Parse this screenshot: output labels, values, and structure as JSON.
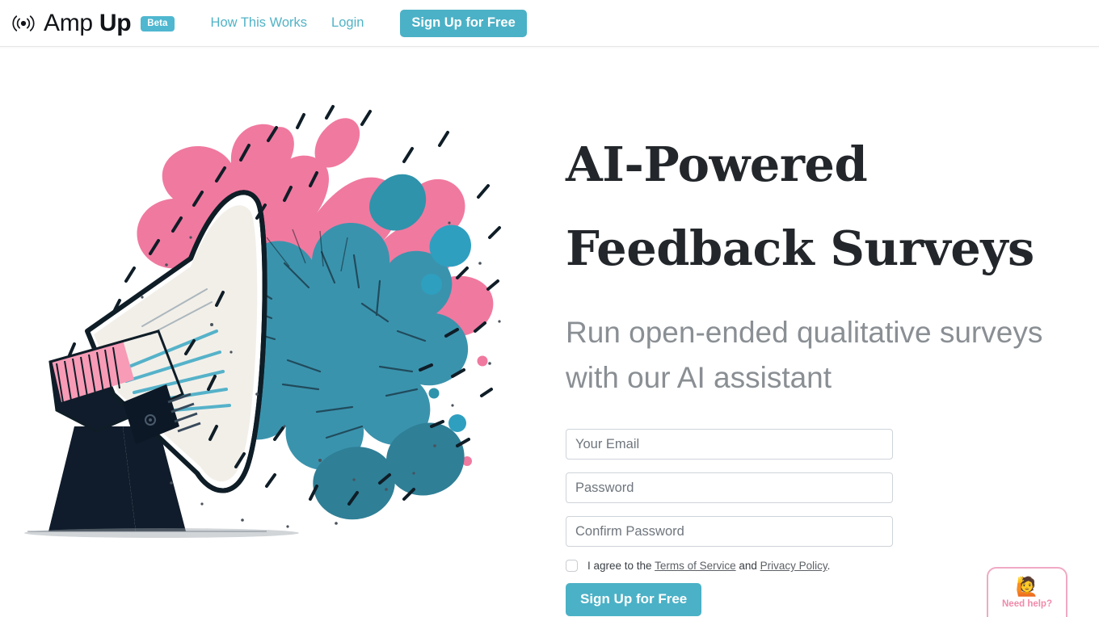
{
  "header": {
    "logo_icon": "broadcast-icon",
    "brand_first": "Amp ",
    "brand_second": "Up",
    "beta_label": "Beta",
    "nav": [
      {
        "label": "How This Works"
      },
      {
        "label": "Login"
      }
    ],
    "cta_label": "Sign Up for Free"
  },
  "hero": {
    "illustration_name": "megaphone-paint-splash-illustration",
    "headline_line1": "AI-Powered",
    "headline_line2": "Feedback Surveys",
    "subheadline": "Run open-ended qualitative surveys with our AI assistant"
  },
  "signup_form": {
    "email_placeholder": "Your Email",
    "email_value": "",
    "password_placeholder": "Password",
    "password_value": "",
    "confirm_password_placeholder": "Confirm Password",
    "confirm_password_value": "",
    "terms_prefix": "I agree to the ",
    "terms_link": "Terms of Service",
    "terms_middle": " and ",
    "privacy_link": "Privacy Policy",
    "terms_suffix": ".",
    "terms_checked": false,
    "submit_label": "Sign Up for Free"
  },
  "help_widget": {
    "emoji": "🙋",
    "label": "Need help?"
  },
  "colors": {
    "accent_teal": "#4bb1c6",
    "nav_link": "#51b3c6",
    "headline": "#23272b",
    "subheadline": "#8a8f94",
    "input_border": "#ced4da",
    "help_pink": "#f08aaa",
    "help_border": "#f0a9c4",
    "splash_teal": "#3a93ad",
    "splash_pink": "#f0799f",
    "megaphone_dark": "#101c2b"
  }
}
